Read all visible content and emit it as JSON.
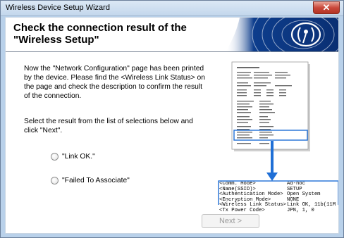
{
  "window": {
    "title": "Wireless Device Setup Wizard",
    "close_glyph": "✕"
  },
  "header": {
    "title_line1": "Check the connection result of the",
    "title_line2": "\"Wireless Setup\"",
    "logo_icon": "wireless-signal-icon"
  },
  "body": {
    "paragraph1": "Now the \"Network Configuration\" page has been printed by the device. Please find the <Wireless Link Status> on the page and check the description to confirm the result of the connection.",
    "paragraph2": "Select the result from the list of selections below and click \"Next\"."
  },
  "options": [
    {
      "label": "\"Link OK.\"",
      "selected": false
    },
    {
      "label": "\"Failed To Associate\"",
      "selected": false
    }
  ],
  "report_excerpt": {
    "rows": [
      {
        "key": "<Comm. Mode>",
        "value": "Ad-hoc"
      },
      {
        "key": "<Name(SSID)>",
        "value": "SETUP"
      },
      {
        "key": "<Authentication Mode>",
        "value": "Open System"
      },
      {
        "key": "<Encryption Mode>",
        "value": "NONE"
      },
      {
        "key": "<Wireless Link Status>",
        "value": "Link OK, 11b(11M"
      },
      {
        "key": "<Tx Power Code>",
        "value": "JPN, 1, 0"
      }
    ]
  },
  "buttons": {
    "next_label": "Next >"
  },
  "colors": {
    "accent": "#0a3f8f",
    "highlight": "#1f6fd6"
  }
}
